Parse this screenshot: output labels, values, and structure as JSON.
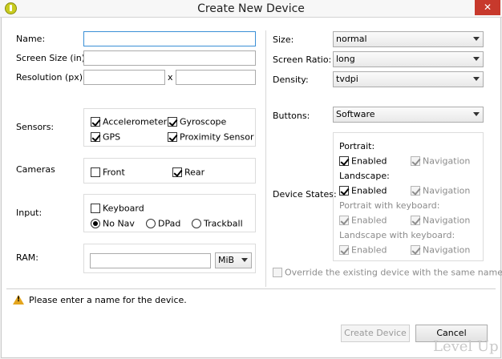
{
  "window": {
    "title": "Create New Device",
    "close_label": "✕"
  },
  "left": {
    "name_label": "Name:",
    "name_value": "",
    "screen_size_label": "Screen Size (in):",
    "screen_size_value": "",
    "resolution_label": "Resolution (px):",
    "resolution_w": "",
    "resolution_x": "x",
    "resolution_h": "",
    "sensors_label": "Sensors:",
    "sensors": [
      {
        "label": "Accelerometer",
        "checked": true
      },
      {
        "label": "Gyroscope",
        "checked": true
      },
      {
        "label": "GPS",
        "checked": true
      },
      {
        "label": "Proximity Sensor",
        "checked": true
      }
    ],
    "cameras_label": "Cameras",
    "cameras": [
      {
        "label": "Front",
        "checked": false
      },
      {
        "label": "Rear",
        "checked": true
      }
    ],
    "input_label": "Input:",
    "keyboard": {
      "label": "Keyboard",
      "checked": false
    },
    "nav": [
      {
        "label": "No Nav",
        "selected": true
      },
      {
        "label": "DPad",
        "selected": false
      },
      {
        "label": "Trackball",
        "selected": false
      }
    ],
    "ram_label": "RAM:",
    "ram_value": "",
    "ram_unit": "MiB"
  },
  "right": {
    "size_label": "Size:",
    "size_value": "normal",
    "ratio_label": "Screen Ratio:",
    "ratio_value": "long",
    "density_label": "Density:",
    "density_value": "tvdpi",
    "buttons_label": "Buttons:",
    "buttons_value": "Software",
    "device_states_label": "Device States:",
    "states": [
      {
        "title": "Portrait:",
        "disabled": false,
        "enabled_label": "Enabled",
        "enabled": true,
        "nav_label": "Navigation",
        "nav": true
      },
      {
        "title": "Landscape:",
        "disabled": false,
        "enabled_label": "Enabled",
        "enabled": true,
        "nav_label": "Navigation",
        "nav": true
      },
      {
        "title": "Portrait with keyboard:",
        "disabled": true,
        "enabled_label": "Enabled",
        "enabled": true,
        "nav_label": "Navigation",
        "nav": true
      },
      {
        "title": "Landscape with keyboard:",
        "disabled": true,
        "enabled_label": "Enabled",
        "enabled": true,
        "nav_label": "Navigation",
        "nav": true
      }
    ],
    "override_label": "Override the existing device with the same name",
    "override_checked": false
  },
  "footer": {
    "warning": "Please enter a name for the device.",
    "create_label": "Create Device",
    "cancel_label": "Cancel"
  },
  "watermark": "Level Up"
}
